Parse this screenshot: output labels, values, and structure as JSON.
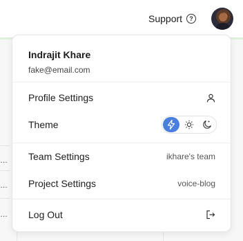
{
  "header": {
    "support_label": "Support",
    "help_icon": "question-circle-icon",
    "avatar_icon": "user-avatar"
  },
  "menu": {
    "user_name": "Indrajit Khare",
    "user_email": "fake@email.com",
    "profile_settings_label": "Profile Settings",
    "profile_icon": "user-icon",
    "theme_label": "Theme",
    "theme_options": [
      "system",
      "light",
      "dark"
    ],
    "theme_selected": "system",
    "team_settings_label": "Team Settings",
    "team_name": "ikhare's team",
    "project_settings_label": "Project Settings",
    "project_name": "voice-blog",
    "logout_label": "Log Out",
    "logout_icon": "logout-icon"
  },
  "colors": {
    "theme_active": "#4a7fe0",
    "header_accent": "#dfeedd"
  }
}
